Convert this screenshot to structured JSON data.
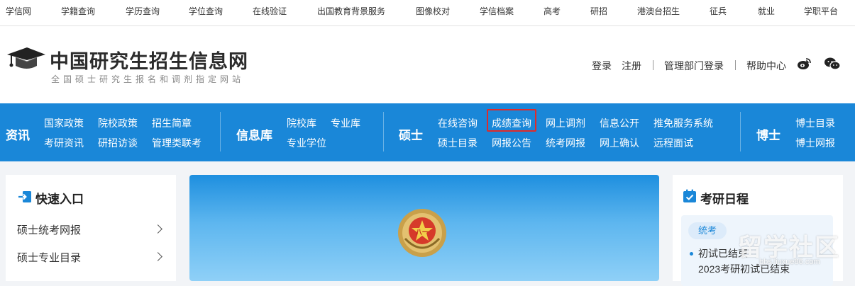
{
  "topbar": {
    "links": [
      "学信网",
      "学籍查询",
      "学历查询",
      "学位查询",
      "在线验证",
      "出国教育背景服务",
      "图像校对",
      "学信档案",
      "高考",
      "研招",
      "港澳台招生",
      "征兵",
      "就业",
      "学职平台"
    ]
  },
  "header": {
    "title": "中国研究生招生信息网",
    "subtitle": "全国硕士研究生报名和调剂指定网站",
    "login": "登录",
    "register": "注册",
    "admin_login": "管理部门登录",
    "help": "帮助中心"
  },
  "nav": {
    "news": {
      "label": "资讯",
      "row1": [
        "国家政策",
        "院校政策",
        "招生简章"
      ],
      "row2": [
        "考研资讯",
        "研招访谈",
        "管理类联考"
      ]
    },
    "library": {
      "label": "信息库",
      "row1": [
        "院校库",
        "专业库"
      ],
      "row2": [
        "专业学位"
      ]
    },
    "master": {
      "label": "硕士",
      "row1": [
        "在线咨询",
        "成绩查询",
        "网上调剂",
        "信息公开",
        "推免服务系统"
      ],
      "row2": [
        "硕士目录",
        "网报公告",
        "统考网报",
        "网上确认",
        "远程面试"
      ]
    },
    "doctor": {
      "label": "博士",
      "row1": [
        "博士目录"
      ],
      "row2": [
        "博士网报"
      ]
    },
    "highlight_color": "#e02a2a",
    "bg_color": "#1a87d8"
  },
  "quick_entry": {
    "title": "快速入口",
    "items": [
      "硕士统考网报",
      "硕士专业目录"
    ]
  },
  "schedule": {
    "title": "考研日程",
    "tag": "统考",
    "line1": "初试已结束",
    "line2": "2023考研初试已结束"
  },
  "watermark": {
    "text": "留学社区",
    "url": "bbs.liuxue86.com"
  }
}
